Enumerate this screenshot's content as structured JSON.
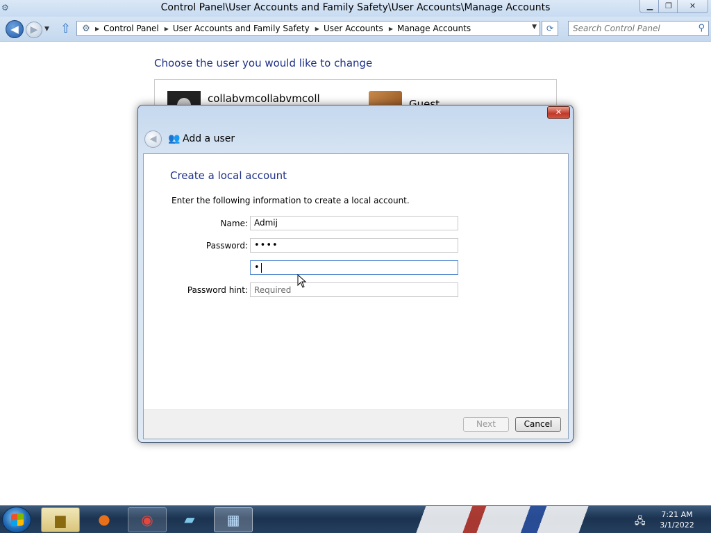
{
  "window": {
    "title": "Control Panel\\User Accounts and Family Safety\\User Accounts\\Manage Accounts",
    "min_glyph": "▁",
    "max_glyph": "❐",
    "close_glyph": "✕"
  },
  "addressbar": {
    "back_glyph": "◀",
    "forward_glyph": "▶",
    "dropdown_glyph": "▼",
    "up_glyph": "⇧",
    "breadcrumbs": [
      "Control Panel",
      "User Accounts and Family Safety",
      "User Accounts",
      "Manage Accounts"
    ],
    "separator_glyph": "▶",
    "refresh_glyph": "⟳",
    "search_placeholder": "Search Control Panel",
    "search_glyph": "⚲"
  },
  "main": {
    "heading": "Choose the user you would like to change",
    "users": [
      {
        "name": "collabvmcollabvmcoll"
      },
      {
        "name": "Guest"
      }
    ]
  },
  "dialog": {
    "title": "Add a user",
    "close_glyph": "✕",
    "back_glyph": "◀",
    "heading": "Create a local account",
    "instructions": "Enter the following information to create a local account.",
    "fields": {
      "name_label": "Name:",
      "name_value": "Admij",
      "password_label": "Password:",
      "password_value": "••••",
      "confirm_value": "•",
      "hint_label": "Password hint:",
      "hint_placeholder": "Required"
    },
    "buttons": {
      "next": "Next",
      "cancel": "Cancel"
    }
  },
  "taskbar": {
    "apps": [
      "windows-explorer",
      "firefox",
      "chrome",
      "notepad",
      "control-panel"
    ],
    "clock_time": "7:21 AM",
    "clock_date": "3/1/2022"
  }
}
